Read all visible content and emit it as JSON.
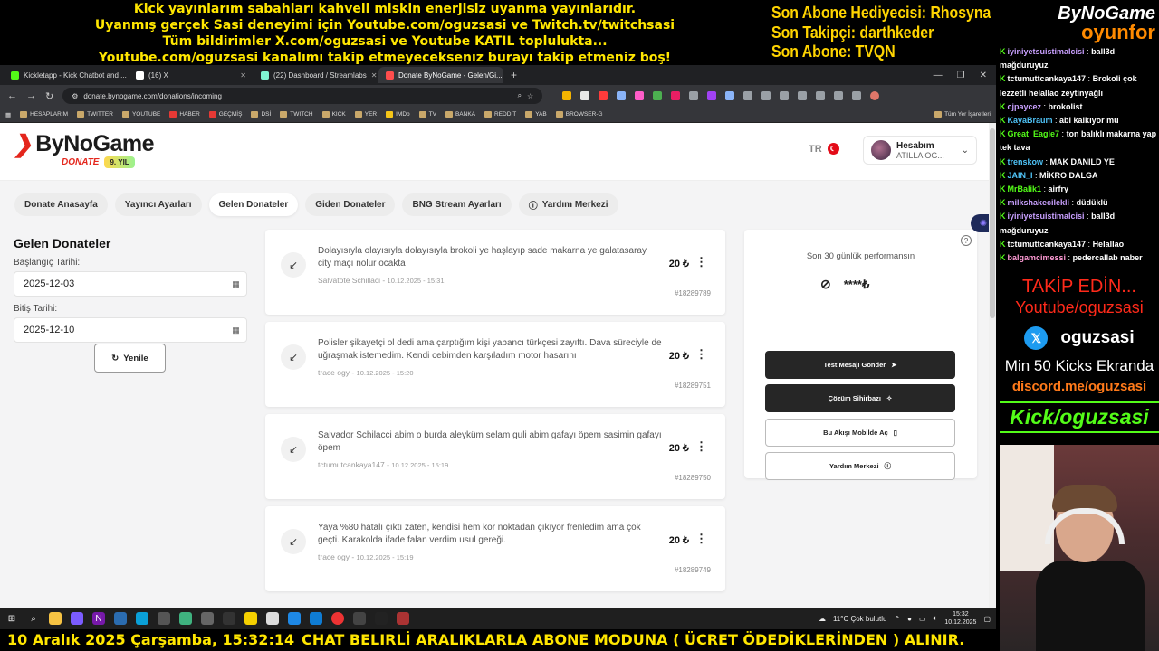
{
  "overlay": {
    "lines": [
      "Kick yayınlarım sabahları kahveli miskin enerjisiz uyanma yayınlarıdır.",
      "Uyanmış gerçek Sasi deneyimi için Youtube.com/oguzsasi ve Twitch.tv/twitchsasi",
      "Tüm bildirimler X.com/oguzsasi ve Youtube KATIL toplulukta...",
      "Youtube.com/oguzsasi kanalımı takip etmeyeceksenız burayı takip etmeniz boş!"
    ],
    "subs": [
      "Son Abone Hediyecisi: Rhosyna",
      "Son Takipçi: darthkeder",
      "Son Abone: TVQN"
    ],
    "brand_top": "ByNoGame",
    "brand_top_sub": "oyunfor"
  },
  "browser": {
    "tabs": [
      {
        "title": "Kickletapp - Kick Chatbot and ...",
        "color": "#53fc18"
      },
      {
        "title": "(16) X",
        "color": "#ffffff"
      },
      {
        "title": "(22) Dashboard / Streamlabs",
        "color": "#80f5d2"
      },
      {
        "title": "Donate ByNoGame - Gelen/Gi...",
        "color": "#ff4d4d"
      }
    ],
    "url": "donate.bynogame.com/donations/incoming",
    "bookmarks": [
      "HESAPLARIM",
      "TWITTER",
      "YOUTUBE",
      "HABER",
      "GEÇMİŞ",
      "DSİ",
      "TWITCH",
      "KICK",
      "YER",
      "IMDb",
      "TV",
      "BANKA",
      "REDDIT",
      "YAB",
      "BROWSER-G"
    ],
    "bookmarks_all": "Tüm Yer İşaretleri"
  },
  "site": {
    "logo": "ByNoGame",
    "logo_sub": "DONATE",
    "badge": "9. YIL",
    "lang": "TR",
    "account_label": "Hesabım",
    "account_name": "ATILLA OG...",
    "nav": [
      "Donate Anasayfa",
      "Yayıncı Ayarları",
      "Gelen Donateler",
      "Giden Donateler",
      "BNG Stream Ayarları",
      "Yardım Merkezi"
    ],
    "filter": {
      "title": "Gelen Donateler",
      "start_label": "Başlangıç Tarihi:",
      "start_value": "2025-12-03",
      "end_label": "Bitiş Tarihi:",
      "end_value": "2025-12-10",
      "refresh": "Yenile"
    },
    "donations": [
      {
        "message": "Dolayısıyla olayısıyla dolayısıyla brokoli ye haşlayıp sade makarna ye galatasaray city maçı nolur ocakta",
        "user": "Salvatote Schillaci",
        "time": "10.12.2025 - 15:31",
        "amount": "20 ₺",
        "id": "#18289789"
      },
      {
        "message": "Polisler şikayetçi ol dedi ama çarptığım kişi yabancı türkçesi zayıftı. Dava süreciyle de uğraşmak istemedim. Kendi cebimden karşıladım motor hasarını",
        "user": "trace ogy",
        "time": "10.12.2025 - 15:20",
        "amount": "20 ₺",
        "id": "#18289751"
      },
      {
        "message": "Salvador Schilacci abim o burda aleyküm selam guli abim gafayı öpem sasimin gafayı öpem",
        "user": "tctumutcankaya147",
        "time": "10.12.2025 - 15:19",
        "amount": "20 ₺",
        "id": "#18289750"
      },
      {
        "message": "Yaya %80 hatalı çıktı zaten, kendisi hem kör noktadan çıkıyor frenledim ama çok geçti. Karakolda ifade falan verdim usul gereği.",
        "user": "trace ogy",
        "time": "10.12.2025 - 15:19",
        "amount": "20 ₺",
        "id": "#18289749"
      }
    ],
    "performance": {
      "title": "Son 30 günlük performansın",
      "hidden_value": "****₺",
      "buttons": [
        "Test Mesajı Gönder",
        "Çözüm Sihirbazı",
        "Bu Akışı Mobilde Aç",
        "Yardım Merkezi"
      ]
    }
  },
  "taskbar": {
    "weather": "11°C  Çok bulutlu",
    "time": "15:32",
    "date": "10.12.2025"
  },
  "ticker": {
    "date": "10 Aralık 2025 Çarşamba, 15:32:14",
    "message": "CHAT BELIRLİ ARALIKLARLA ABONE MODUNA ( ÜCRET ÖDEDİKLERİNDEN ) ALINIR."
  },
  "chat": [
    {
      "user": "iyiniyetsuistimalcisi",
      "color": "#c9a0ff",
      "text": "ball3d mağduruyuz"
    },
    {
      "user": "tctumuttcankaya147",
      "color": "#ffffff",
      "text": "Brokoli çok lezzetli helallao zeytinyağlı"
    },
    {
      "user": "cjpaycez",
      "color": "#c9a0ff",
      "text": "brokolist"
    },
    {
      "user": "KayaBraum",
      "color": "#4fc3f7",
      "text": "abi kalkıyor mu"
    },
    {
      "user": "Great_Eagle7",
      "color": "#53fc18",
      "text": "ton balıklı makarna yap tek tava"
    },
    {
      "user": "trenskow",
      "color": "#4fc3f7",
      "text": "MAK DANILD YE"
    },
    {
      "user": "JAIN_I",
      "color": "#4fc3f7",
      "text": "MİKRO DALGA"
    },
    {
      "user": "MrBalik1",
      "color": "#53fc18",
      "text": "airfry"
    },
    {
      "user": "milkshakecilekli",
      "color": "#c9a0ff",
      "text": "düdüklü"
    },
    {
      "user": "iyiniyetsuistimalcisi",
      "color": "#c9a0ff",
      "text": "ball3d mağduruyuz"
    },
    {
      "user": "tctumuttcankaya147",
      "color": "#ffffff",
      "text": "Helallao"
    },
    {
      "user": "balgamcimessi",
      "color": "#ff9ad5",
      "text": "pedercallab naber"
    }
  ],
  "promo": {
    "follow": "TAKİP EDİN...",
    "youtube": "Youtube/oguzsasi",
    "x_handle": "oguzsasi",
    "kicks": "Min 50 Kicks Ekranda",
    "discord": "discord.me/oguzsasi",
    "kick": "Kick/oguzsasi"
  }
}
